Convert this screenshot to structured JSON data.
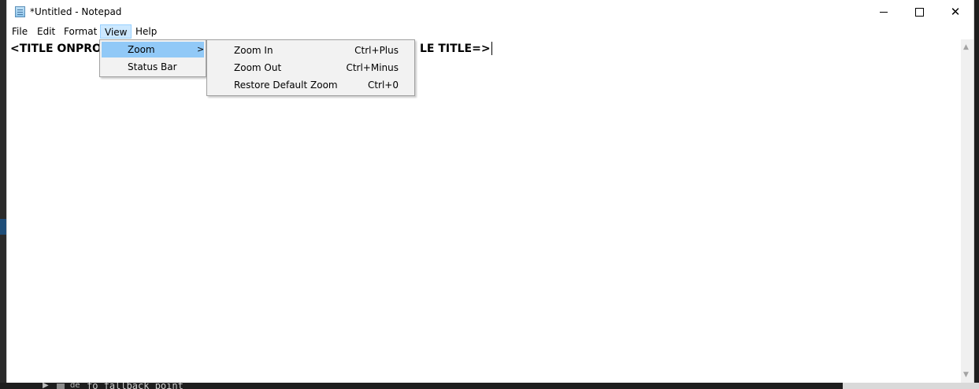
{
  "window": {
    "title": "*Untitled - Notepad",
    "app_icon": "notepad-icon"
  },
  "menubar": {
    "items": [
      "File",
      "Edit",
      "Format",
      "View",
      "Help"
    ],
    "active": "View"
  },
  "editor": {
    "text_left": "<TITLE ONPRO",
    "text_right": "LE TITLE=>"
  },
  "view_menu": {
    "items": [
      {
        "label": "Zoom",
        "submenu_arrow": ">",
        "highlighted": true
      },
      {
        "label": "Status Bar"
      }
    ]
  },
  "zoom_submenu": {
    "items": [
      {
        "label": "Zoom In",
        "shortcut": "Ctrl+Plus"
      },
      {
        "label": "Zoom Out",
        "shortcut": "Ctrl+Minus"
      },
      {
        "label": "Restore Default Zoom",
        "shortcut": "Ctrl+0"
      }
    ]
  },
  "background": {
    "code_text": "fo fallback point",
    "lang_label": "de",
    "arrow": "▶"
  },
  "colors": {
    "menu_active_bg": "#cce8ff",
    "dropdown_highlight": "#91c9f7",
    "menu_bg": "#f2f2f2"
  }
}
